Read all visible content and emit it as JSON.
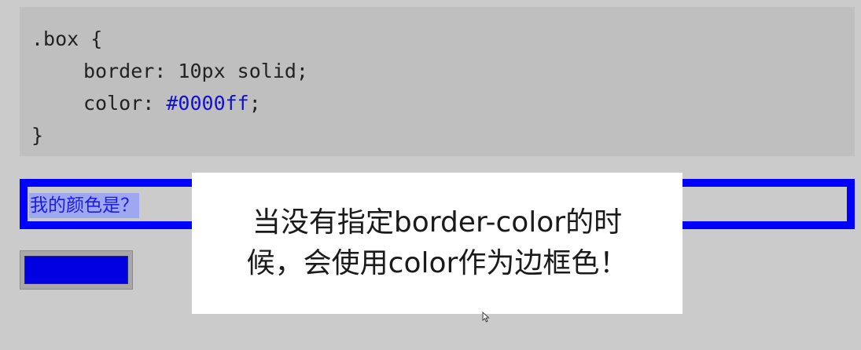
{
  "code": {
    "line1": ".box {",
    "line2": "border: 10px solid;",
    "line3_prop": "color: ",
    "line3_value": "#0000ff",
    "line3_end": ";",
    "line4": "}"
  },
  "demo": {
    "text": "我的颜色是？"
  },
  "subtitle": {
    "text": "当没有指定border-color的时候，会使用color作为边框色！"
  },
  "colors": {
    "accent": "#0000ff",
    "panel": "#bfbfbf",
    "background": "#cbcbcb"
  },
  "icons": {
    "cursor": "mouse-pointer-icon"
  }
}
